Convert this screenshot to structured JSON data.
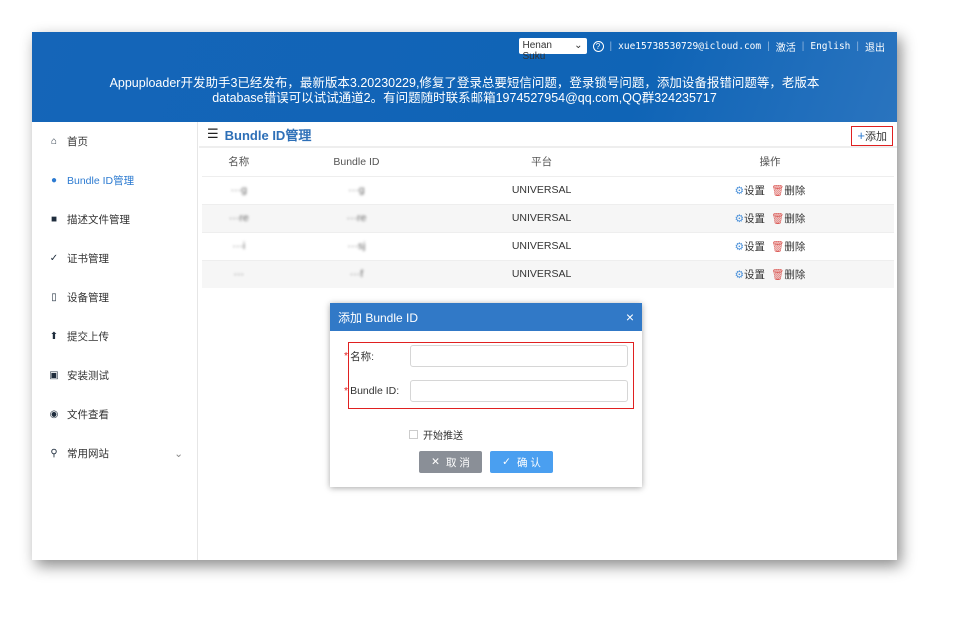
{
  "header": {
    "region_select": "Henan Suku",
    "help_icon": "question-circle-icon",
    "email": "xue15738530729@icloud.com",
    "activate": "激活",
    "language": "English",
    "logout": "退出",
    "notice_line1": "Appuploader开发助手3已经发布，最新版本3.20230229,修复了登录总要短信问题，登录锁号问题，添加设备报错问题等，老版本",
    "notice_line2": "database错误可以试试通道2。有问题随时联系邮箱1974527954@qq.com,QQ群324235717"
  },
  "sidebar": {
    "items": [
      {
        "label": "首页",
        "icon": "home-icon"
      },
      {
        "label": "Bundle ID管理",
        "icon": "info-circle-icon",
        "active": true
      },
      {
        "label": "描述文件管理",
        "icon": "files-icon"
      },
      {
        "label": "证书管理",
        "icon": "check-circle-icon"
      },
      {
        "label": "设备管理",
        "icon": "phone-icon"
      },
      {
        "label": "提交上传",
        "icon": "upload-icon"
      },
      {
        "label": "安装测试",
        "icon": "install-icon"
      },
      {
        "label": "文件查看",
        "icon": "eye-icon"
      },
      {
        "label": "常用网站",
        "icon": "location-icon"
      }
    ]
  },
  "page": {
    "title": "Bundle ID管理",
    "add_label": "添加",
    "columns": [
      "名称",
      "Bundle ID",
      "平台",
      "操作"
    ],
    "rows": [
      {
        "name": "···g",
        "bundle_id": "···g",
        "platform": "UNIVERSAL"
      },
      {
        "name": "···re",
        "bundle_id": "···re",
        "platform": "UNIVERSAL"
      },
      {
        "name": "···i",
        "bundle_id": "···sj",
        "platform": "UNIVERSAL"
      },
      {
        "name": "···",
        "bundle_id": "···f",
        "platform": "UNIVERSAL"
      }
    ],
    "settings_label": "设置",
    "delete_label": "删除"
  },
  "dialog": {
    "title": "添加 Bundle ID",
    "name_label": "名称:",
    "bundle_label": "Bundle ID:",
    "name_value": "",
    "bundle_value": "",
    "push_label": "开始推送",
    "cancel": "取 消",
    "confirm": "确 认",
    "cancel_color": "#8a8f97",
    "confirm_color": "#4a9ff0"
  }
}
